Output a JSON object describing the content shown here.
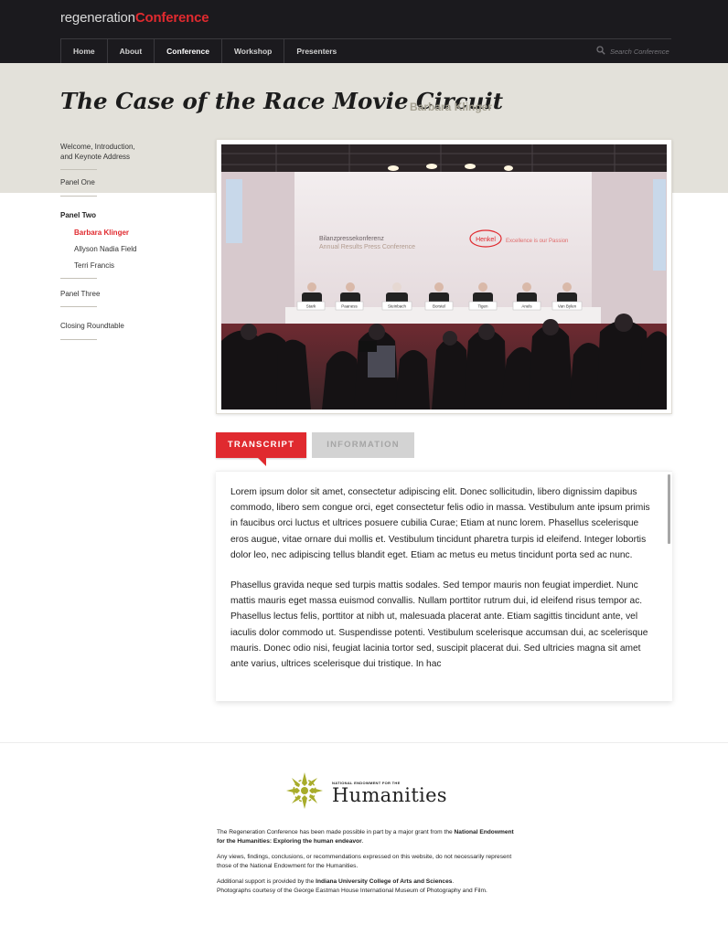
{
  "brand": {
    "prefix": "regeneration",
    "accent": "Conference",
    "accent_color": "#e02a2f"
  },
  "nav": {
    "items": [
      {
        "label": "Home",
        "active": false
      },
      {
        "label": "About",
        "active": false
      },
      {
        "label": "Conference",
        "active": true
      },
      {
        "label": "Workshop",
        "active": false
      },
      {
        "label": "Presenters",
        "active": false
      }
    ],
    "search_placeholder": "Search Conference",
    "search_icon": "search-icon"
  },
  "page": {
    "title": "The Case of the Race Movie Circuit",
    "speaker": "Barbara Klinger"
  },
  "sidebar": {
    "welcome_line1": "Welcome, Introduction,",
    "welcome_line2": "and Keynote Address",
    "panel_one": "Panel One",
    "panel_two": "Panel Two",
    "panel_two_items": [
      "Barbara Klinger",
      "Allyson Nadia Field",
      "Terri Francis"
    ],
    "panel_three": "Panel Three",
    "closing": "Closing Roundtable"
  },
  "photo": {
    "backdrop_title": "Bilanzpressekonferenz",
    "backdrop_subtitle": "Annual Results Press Conference",
    "brand": "Henkel",
    "brand_tagline": "Excellence is our Passion",
    "nameplates": [
      "Stark",
      "Paaness",
      "Steinbach",
      "Borstel",
      "Tigen",
      "Anels",
      "Van Bylen"
    ]
  },
  "tabs": {
    "transcript": "TRANSCRIPT",
    "information": "INFORMATION"
  },
  "transcript": {
    "p1": "Lorem ipsum dolor sit amet, consectetur adipiscing elit. Donec sollicitudin, libero dignissim dapibus commodo, libero sem congue orci, eget consectetur felis odio in massa. Vestibulum ante ipsum primis in faucibus orci luctus et ultrices posuere cubilia Curae; Etiam at nunc lorem. Phasellus scelerisque eros augue, vitae ornare dui mollis et. Vestibulum tincidunt pharetra turpis id eleifend. Integer lobortis dolor leo, nec adipiscing tellus blandit eget. Etiam ac metus eu metus tincidunt porta sed ac nunc.",
    "p2": "Phasellus gravida neque sed turpis mattis sodales. Sed tempor mauris non feugiat imperdiet. Nunc mattis mauris eget massa euismod convallis. Nullam porttitor rutrum dui, id eleifend risus tempor ac. Phasellus lectus felis, porttitor at nibh ut, malesuada placerat ante. Etiam sagittis tincidunt ante, vel iaculis dolor commodo ut. Suspendisse potenti. Vestibulum scelerisque accumsan dui, ac scelerisque mauris. Donec odio nisi, feugiat lacinia tortor sed, suscipit placerat dui. Sed ultricies magna sit amet ante varius, ultrices scelerisque dui tristique. In hac"
  },
  "footer": {
    "logo_small": "NATIONAL ENDOWMENT FOR THE",
    "logo_big": "Humanities",
    "logo_color": "#a8ac2a",
    "grant_pre": "The Regeneration Conference has been made possible in part by a major grant from the ",
    "grant_bold": "National Endowment for the Humanities: Exploring the human endeavor",
    "grant_post": ".",
    "disclaimer": "Any views, findings, conclusions, or recommendations expressed on this website, do not necessarily represent those of the National Endowment for the Humanities.",
    "support_pre": "Additional support is provided by the ",
    "support_bold": "Indiana University College of Arts and Sciences",
    "support_post": ".",
    "photo_credit": "Photographs courtesy of the George Eastman House International Museum of Photography and Film."
  }
}
